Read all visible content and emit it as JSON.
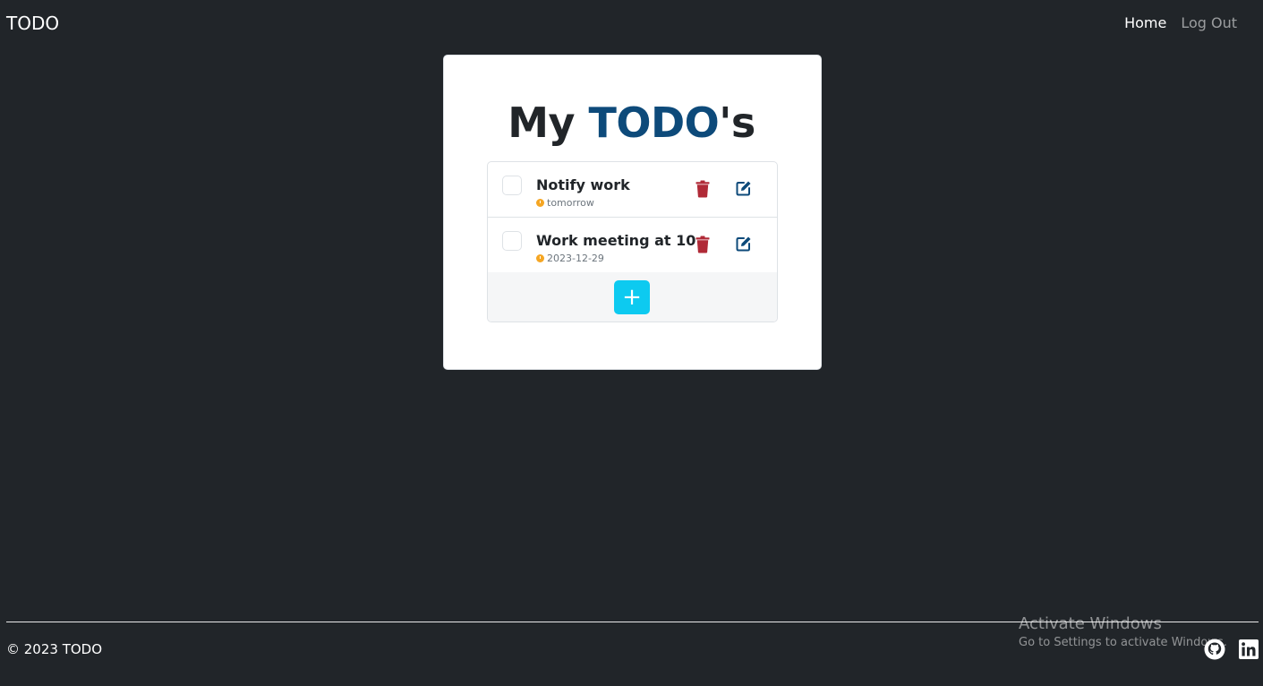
{
  "navbar": {
    "brand": "TODO",
    "links": [
      {
        "label": "Home",
        "active": true
      },
      {
        "label": "Log Out",
        "active": false
      }
    ]
  },
  "heading": {
    "prefix": "My ",
    "accent": "TODO",
    "suffix": "'s"
  },
  "todos": [
    {
      "title": "Notify work",
      "due": "tomorrow",
      "checked": false
    },
    {
      "title": "Work meeting at 10",
      "due": "2023-12-29",
      "checked": false
    }
  ],
  "add_button": {
    "label": "+"
  },
  "footer": {
    "copyright": "© 2023 TODO",
    "social": [
      "github-icon",
      "linkedin-icon"
    ]
  },
  "watermark": {
    "line1": "Activate Windows",
    "line2": "Go to Settings to activate Windows."
  },
  "colors": {
    "background": "#212529",
    "accent": "#0d4a7a",
    "delete": "#b02a37",
    "edit": "#0d4a7a",
    "add": "#0dcaf0",
    "due_icon": "#f5a623"
  }
}
